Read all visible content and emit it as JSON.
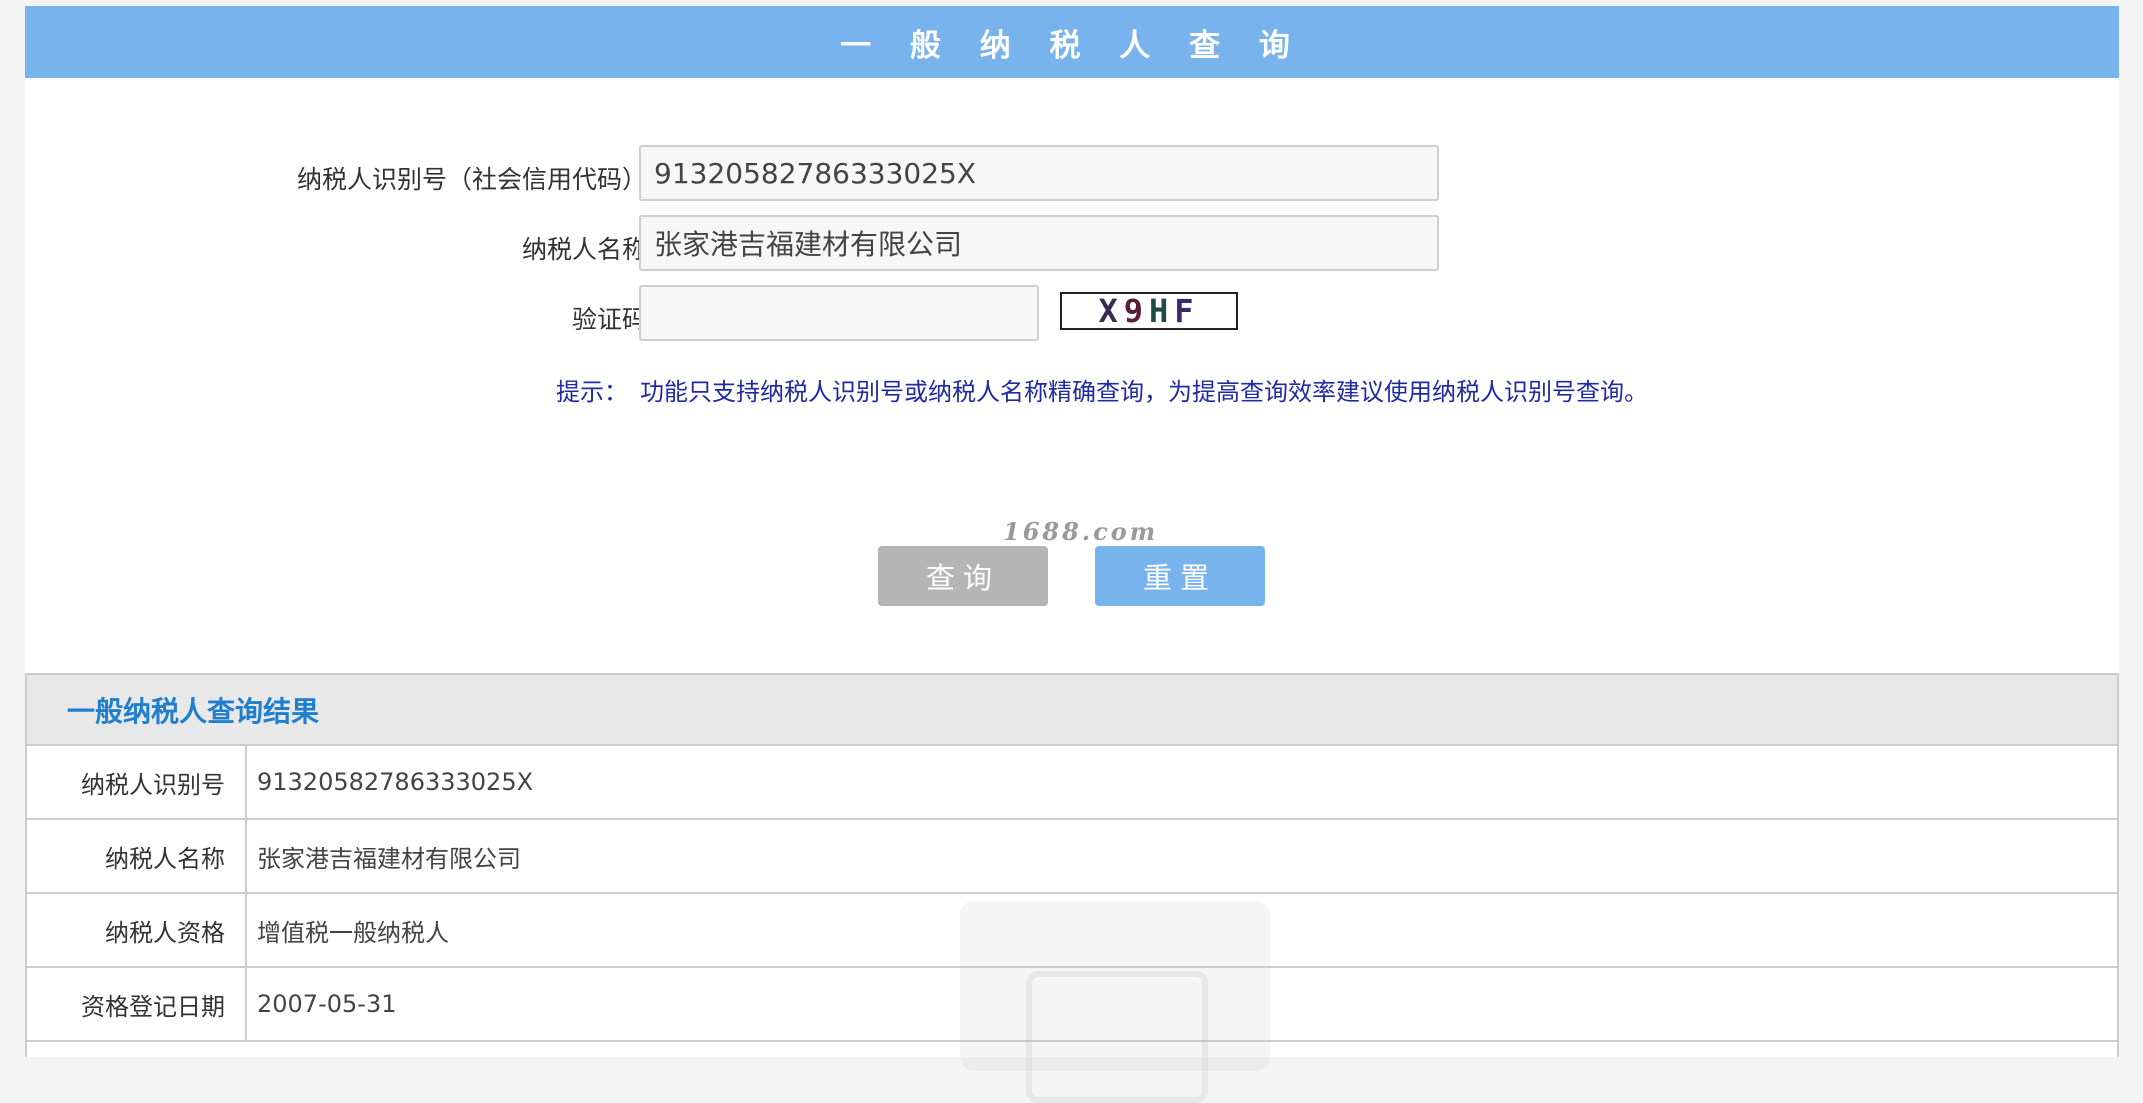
{
  "header": {
    "title": "一 般 纳 税 人 查 询"
  },
  "form": {
    "taxpayer_id_label": "纳税人识别号（社会信用代码）",
    "taxpayer_id_value": "91320582786333025X",
    "taxpayer_name_label": "纳税人名称",
    "taxpayer_name_value": "张家港吉福建材有限公司",
    "captcha_label": "验证码",
    "captcha_value": "",
    "captcha_text": [
      "X",
      "9",
      "H",
      "F"
    ],
    "hint_label": "提示：",
    "hint_text": "功能只支持纳税人识别号或纳税人名称精确查询，为提高查询效率建议使用纳税人识别号查询。"
  },
  "watermark": "1688.com",
  "buttons": {
    "query": "查询",
    "reset": "重置"
  },
  "result": {
    "title": "一般纳税人查询结果",
    "rows": [
      {
        "label": "纳税人识别号",
        "value": "91320582786333025X"
      },
      {
        "label": "纳税人名称",
        "value": "张家港吉福建材有限公司"
      },
      {
        "label": "纳税人资格",
        "value": "增值税一般纳税人"
      },
      {
        "label": "资格登记日期",
        "value": "2007-05-31"
      }
    ]
  },
  "colors": {
    "header_bg": "#79b3ee",
    "query_button": "#b5b5b5",
    "reset_button": "#79b3ee",
    "result_title": "#1f7fcc",
    "hint": "#1f2aa5"
  }
}
